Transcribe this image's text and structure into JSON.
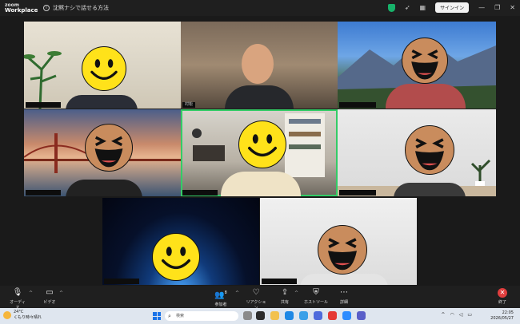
{
  "titlebar": {
    "logo_line1": "zoom",
    "logo_line2": "Workplace",
    "meeting_title": "沈黙ナシで話せる方法",
    "signin_label": "サインイン"
  },
  "tiles": [
    {
      "id": "t1",
      "name": ""
    },
    {
      "id": "t2",
      "name": "村松"
    },
    {
      "id": "t3",
      "name": ""
    },
    {
      "id": "t4",
      "name": ""
    },
    {
      "id": "t5",
      "name": ""
    },
    {
      "id": "t6",
      "name": ""
    },
    {
      "id": "t7",
      "name": ""
    },
    {
      "id": "t8",
      "name": ""
    }
  ],
  "toolbar": {
    "audio_label": "オーディオ",
    "video_label": "ビデオ",
    "participants_label": "参加者",
    "participants_count": "8",
    "reactions_label": "リアクション",
    "share_label": "共有",
    "host_tools_label": "ホストツール",
    "more_label": "詳細",
    "end_label": "終了"
  },
  "taskbar": {
    "weather_temp": "24°C",
    "weather_desc": "くもり時々晴れ",
    "search_placeholder": "検索",
    "time": "22:05",
    "date": "2026/05/27"
  },
  "colors": {
    "active_speaker": "#33cc66",
    "end_button": "#e03e3e",
    "smiley_yellow": "#ffe21a",
    "smiley_tan": "#c98c5d"
  }
}
